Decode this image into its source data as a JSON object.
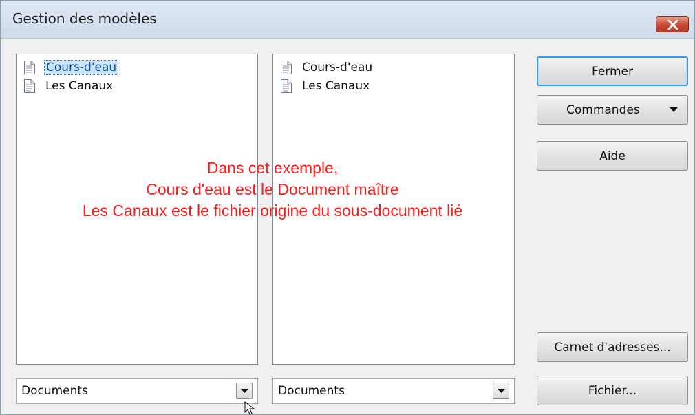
{
  "window": {
    "title": "Gestion des modèles"
  },
  "left_panel": {
    "items": [
      {
        "label": "Cours-d'eau",
        "selected": true
      },
      {
        "label": "Les Canaux",
        "selected": false
      }
    ],
    "combo_value": "Documents"
  },
  "right_panel": {
    "items": [
      {
        "label": "Cours-d'eau",
        "selected": false
      },
      {
        "label": "Les Canaux",
        "selected": false
      }
    ],
    "combo_value": "Documents"
  },
  "buttons": {
    "fermer": "Fermer",
    "commandes": "Commandes",
    "aide": "Aide",
    "carnet": "Carnet d'adresses...",
    "fichier": "Fichier..."
  },
  "annotation": {
    "line1": "Dans cet exemple,",
    "line2": "Cours d'eau est le Document maître",
    "line3": "Les Canaux est le fichier origine du sous-document lié"
  },
  "icons": {
    "close": "close-icon",
    "document": "document-icon",
    "dropdown": "chevron-down-icon",
    "cursor": "mouse-pointer-icon"
  },
  "colors": {
    "annotation": "#ff1a1a",
    "selection": "#cce4f7",
    "focus_border": "#3c9be6",
    "close_button": "#c74a33"
  }
}
